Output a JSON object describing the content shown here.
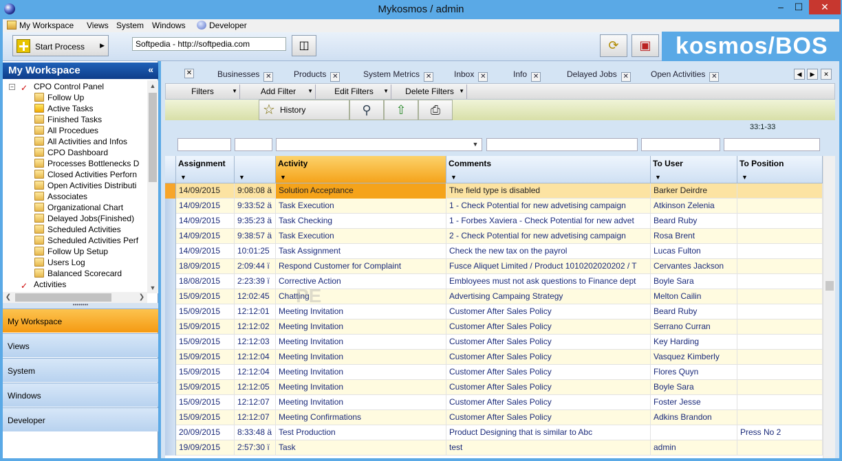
{
  "window": {
    "title": "Mykosmos / admin",
    "min": "–",
    "max": "☐",
    "close": "✕"
  },
  "menu": [
    {
      "label": "My Workspace",
      "key": "M"
    },
    {
      "label": "Views",
      "key": "V"
    },
    {
      "label": "System",
      "key": "S"
    },
    {
      "label": "Windows",
      "key": "W"
    },
    {
      "label": "Developer",
      "key": "D"
    }
  ],
  "toolbar": {
    "start_process": "Start Process",
    "url": "Softpedia - http://softpedia.com",
    "brand": "kosmos/BOS"
  },
  "left": {
    "header": "My Workspace",
    "collapse_glyph": "«",
    "tree": [
      {
        "label": "CPO Control Panel",
        "level": 0,
        "icon": "checkmark-icon"
      },
      {
        "label": "Follow Up",
        "level": 1,
        "icon": "folder-icon"
      },
      {
        "label": "Active Tasks",
        "level": 1,
        "icon": "star-folder-icon"
      },
      {
        "label": "Finished Tasks",
        "level": 1,
        "icon": "folder-icon"
      },
      {
        "label": "All Procedues",
        "level": 1,
        "icon": "folder-icon"
      },
      {
        "label": "All Activities and Infos",
        "level": 1,
        "icon": "folder-icon"
      },
      {
        "label": "CPO Dashboard",
        "level": 1,
        "icon": "folder-icon"
      },
      {
        "label": "Processes Bottlenecks D",
        "level": 1,
        "icon": "folder-icon"
      },
      {
        "label": "Closed Activities Perforn",
        "level": 1,
        "icon": "folder-icon"
      },
      {
        "label": "Open Activities Distributi",
        "level": 1,
        "icon": "folder-icon"
      },
      {
        "label": "Associates",
        "level": 1,
        "icon": "folder-icon"
      },
      {
        "label": "Organizational Chart",
        "level": 1,
        "icon": "folder-icon"
      },
      {
        "label": "Delayed Jobs(Finished)",
        "level": 1,
        "icon": "folder-icon"
      },
      {
        "label": "Scheduled Activities",
        "level": 1,
        "icon": "folder-icon"
      },
      {
        "label": "Scheduled Activities Perf",
        "level": 1,
        "icon": "folder-icon"
      },
      {
        "label": "Follow Up Setup",
        "level": 1,
        "icon": "folder-icon"
      },
      {
        "label": "Users Log",
        "level": 1,
        "icon": "folder-icon"
      },
      {
        "label": "Balanced Scorecard",
        "level": 1,
        "icon": "folder-icon"
      },
      {
        "label": "Activities",
        "level": 0,
        "icon": "checkmark-icon"
      }
    ],
    "nav": [
      {
        "label": "My Workspace",
        "active": true
      },
      {
        "label": "Views",
        "active": false
      },
      {
        "label": "System",
        "active": false
      },
      {
        "label": "Windows",
        "active": false
      },
      {
        "label": "Developer",
        "active": false
      }
    ]
  },
  "tabs": [
    "Businesses",
    "Products",
    "System Metrics",
    "Inbox",
    "Info",
    "Delayed Jobs",
    "Open Activities"
  ],
  "filters": {
    "filters": "Filters",
    "add_filter": "Add Filter",
    "edit_filters": "Edit Filters",
    "delete_filters": "Delete Filters"
  },
  "actions": {
    "history": "History"
  },
  "grid": {
    "counter": "33:1-33",
    "columns": [
      "Assignment",
      "",
      "Activity",
      "Comments",
      "To User",
      "To Position"
    ],
    "rows": [
      [
        "14/09/2015",
        "9:08:08 ä",
        "Solution Acceptance",
        "The field type is disabled",
        "Barker Deirdre",
        ""
      ],
      [
        "14/09/2015",
        "9:33:52 ä",
        "Task Execution",
        "1 - Check Potential for new advetising campaign",
        "Atkinson Zelenia",
        ""
      ],
      [
        "14/09/2015",
        "9:35:23 ä",
        "Task Checking",
        "1 - Forbes Xaviera - Check Potential for new advet",
        "Beard Ruby",
        ""
      ],
      [
        "14/09/2015",
        "9:38:57 ä",
        "Task Execution",
        "2 - Check Potential for new advetising campaign",
        "Rosa Brent",
        ""
      ],
      [
        "14/09/2015",
        "10:01:25",
        "Task Assignment",
        "Check the new tax on the payrol",
        "Lucas Fulton",
        ""
      ],
      [
        "18/09/2015",
        "2:09:44 ï",
        "Respond Customer for Complaint",
        "Fusce Aliquet Limited / Product 1010202020202 / T",
        "Cervantes Jackson",
        ""
      ],
      [
        "18/08/2015",
        "2:23:39 ï",
        "Corrective Action",
        "Embloyees must not ask questions to Finance dept",
        "Boyle Sara",
        ""
      ],
      [
        "15/09/2015",
        "12:02:45",
        "Chatting",
        "Advertising Campaing Strategy",
        "Melton Cailin",
        ""
      ],
      [
        "15/09/2015",
        "12:12:01",
        "Meeting Invitation",
        "Customer After Sales Policy",
        "Beard Ruby",
        ""
      ],
      [
        "15/09/2015",
        "12:12:02",
        "Meeting Invitation",
        "Customer After Sales Policy",
        "Serrano Curran",
        ""
      ],
      [
        "15/09/2015",
        "12:12:03",
        "Meeting Invitation",
        "Customer After Sales Policy",
        "Key Harding",
        ""
      ],
      [
        "15/09/2015",
        "12:12:04",
        "Meeting Invitation",
        "Customer After Sales Policy",
        "Vasquez Kimberly",
        ""
      ],
      [
        "15/09/2015",
        "12:12:04",
        "Meeting Invitation",
        "Customer After Sales Policy",
        "Flores Quyn",
        ""
      ],
      [
        "15/09/2015",
        "12:12:05",
        "Meeting Invitation",
        "Customer After Sales Policy",
        "Boyle Sara",
        ""
      ],
      [
        "15/09/2015",
        "12:12:07",
        "Meeting Invitation",
        "Customer After Sales Policy",
        "Foster Jesse",
        ""
      ],
      [
        "15/09/2015",
        "12:12:07",
        "Meeting Confirmations",
        "Customer After Sales Policy",
        "Adkins Brandon",
        ""
      ],
      [
        "20/09/2015",
        "8:33:48 ä",
        "Test Production",
        "Product Designing that is similar to Abc",
        "",
        "Press No 2"
      ],
      [
        "19/09/2015",
        "2:57:30 ï",
        "Task",
        "test",
        "admin",
        ""
      ]
    ]
  },
  "watermark": "PE"
}
